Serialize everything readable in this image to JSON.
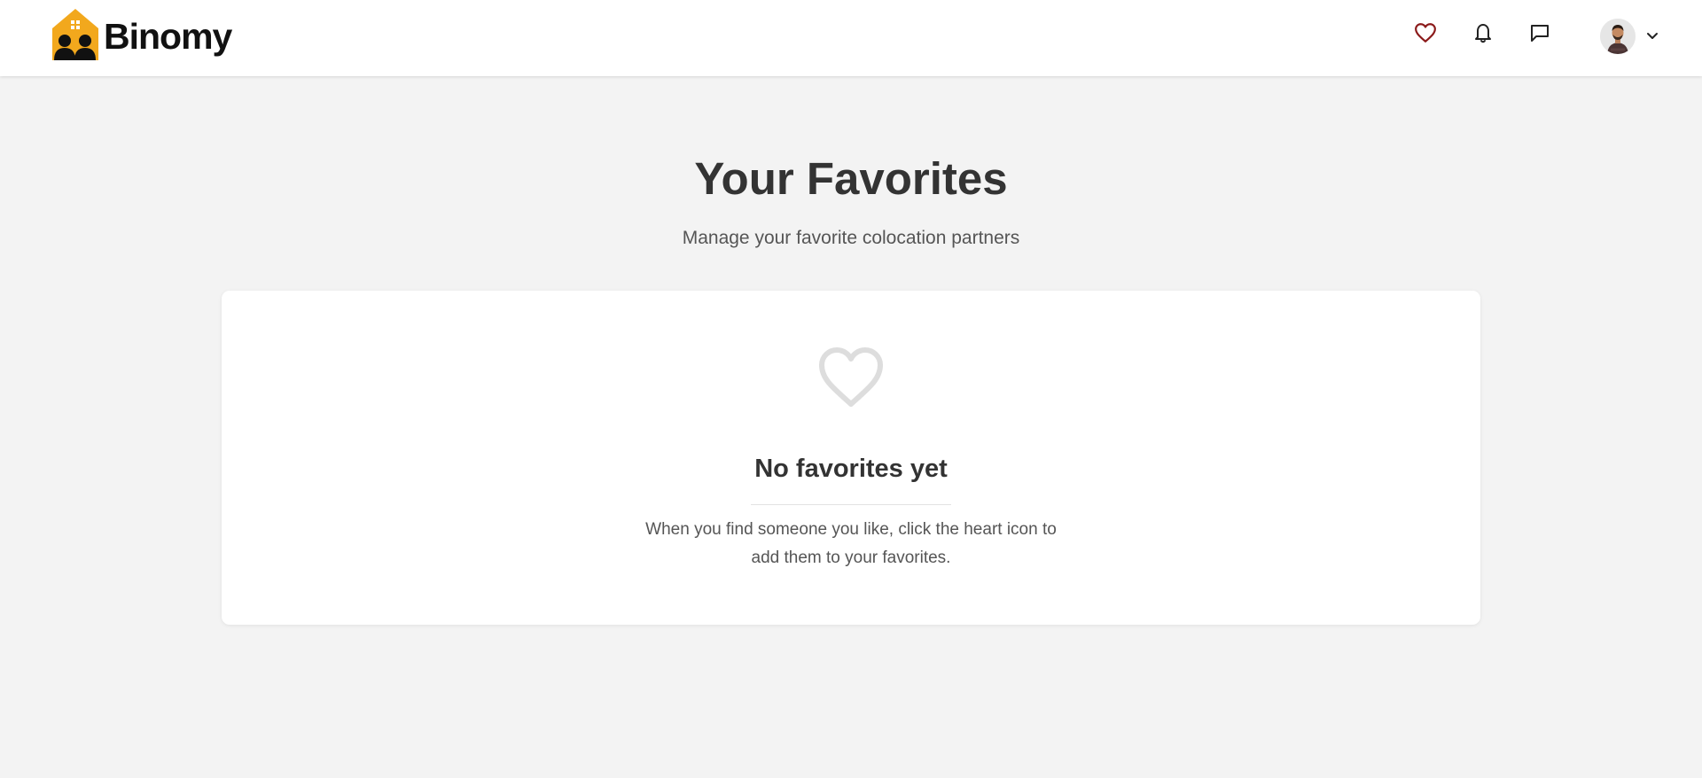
{
  "brand": {
    "name": "Binomy",
    "logo_icon": "house-people-icon",
    "logo_color": "#F2A81D"
  },
  "header": {
    "icons": [
      {
        "name": "favorites-heart-icon",
        "color": "#8B1A1A",
        "active": true
      },
      {
        "name": "notifications-bell-icon",
        "color": "#222222"
      },
      {
        "name": "messages-chat-icon",
        "color": "#222222"
      }
    ],
    "user_menu": {
      "avatar": "user-avatar",
      "dropdown_icon": "chevron-down-icon"
    }
  },
  "main": {
    "title": "Your Favorites",
    "subtitle": "Manage your favorite colocation partners",
    "empty_state": {
      "icon": "heart-outline-icon",
      "icon_color": "#DDDDDD",
      "title": "No favorites yet",
      "message": "When you find someone you like, click the heart icon to add them to your favorites."
    }
  },
  "colors": {
    "background": "#F3F3F3",
    "card": "#FFFFFF",
    "text_primary": "#333333",
    "text_secondary": "#555555"
  }
}
